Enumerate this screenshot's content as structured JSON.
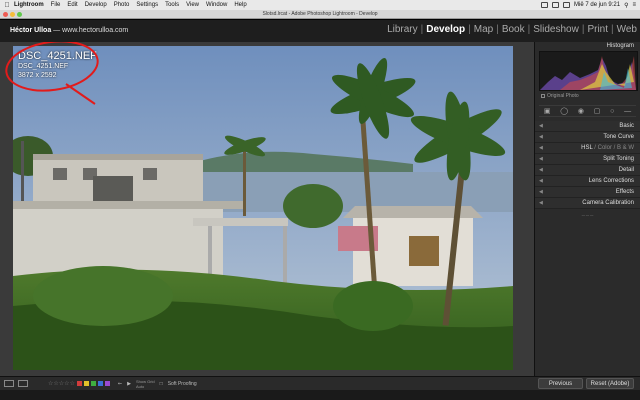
{
  "menubar": {
    "app": "Lightroom",
    "items": [
      "File",
      "Edit",
      "Develop",
      "Photo",
      "Settings",
      "Tools",
      "View",
      "Window",
      "Help"
    ],
    "datetime": "Miê 7 de jun 9:21"
  },
  "window": {
    "title": "Slotsd.lrcat - Adobe Photoshop Lightroom - Develop"
  },
  "identity": {
    "name": "Héctor Ulloa",
    "site": " — www.hectorulloa.com"
  },
  "modules": [
    "Library",
    "Develop",
    "Map",
    "Book",
    "Slideshow",
    "Print",
    "Web"
  ],
  "active_module": "Develop",
  "photo_info": {
    "filename": "DSC_4251.NEF",
    "filename2": "DSC_4251.NEF",
    "dimensions": "3872 x 2592"
  },
  "right_panel": {
    "histogram_label": "Histogram",
    "original_photo": "Original Photo",
    "sections": [
      "Basic",
      "Tone Curve",
      "Split Toning",
      "Detail",
      "Lens Corrections",
      "Effects",
      "Camera Calibration"
    ],
    "hsl": {
      "a": "HSL",
      "b": "Color",
      "c": "B & W"
    }
  },
  "toolbar": {
    "soft_proofing": "Soft Proofing",
    "show_grid": "Show Grid",
    "auto": "Auto",
    "previous": "Previous",
    "reset": "Reset (Adobe)"
  },
  "colors": {
    "flags": [
      "#d23c3c",
      "#e0c02a",
      "#3fae3f",
      "#3a6fd6",
      "#9a4ad0"
    ]
  }
}
